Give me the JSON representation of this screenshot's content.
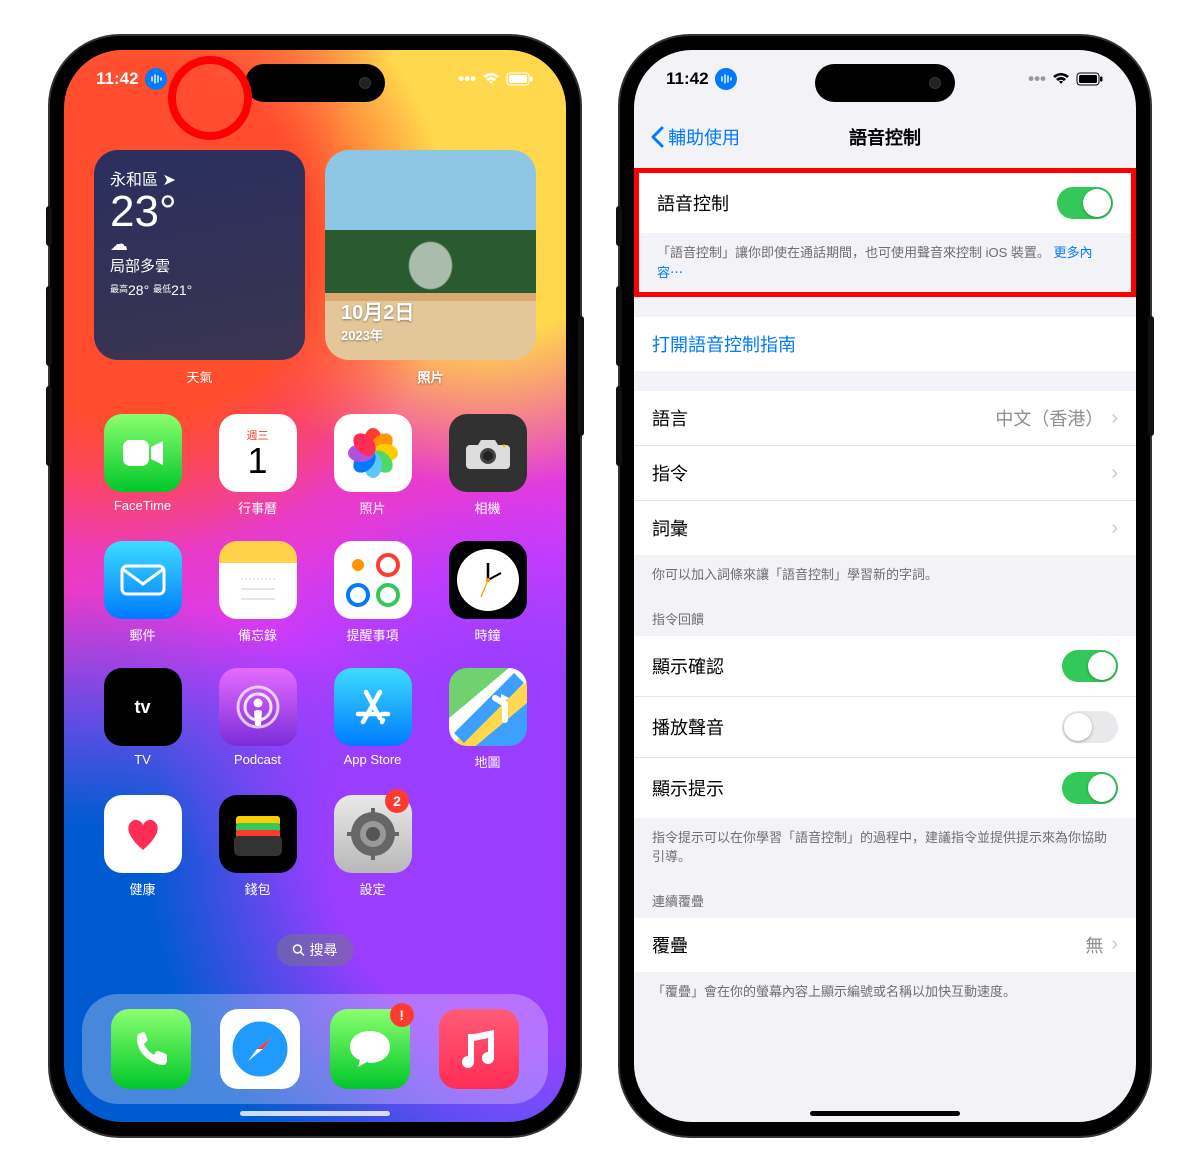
{
  "home": {
    "status": {
      "time": "11:42"
    },
    "weather": {
      "location": "永和區",
      "temp": "23°",
      "condition": "局部多雲",
      "hi_label": "最高",
      "hi": "28°",
      "lo_label": "最低",
      "lo": "21°",
      "widget_label": "天氣"
    },
    "photos_widget": {
      "date": "10月2日",
      "year": "2023年",
      "widget_label": "照片"
    },
    "apps": {
      "facetime": "FaceTime",
      "calendar": {
        "label": "行事曆",
        "dow": "週三",
        "day": "1"
      },
      "photos": "照片",
      "camera": "相機",
      "mail": "郵件",
      "notes": "備忘錄",
      "reminders": "提醒事項",
      "clock": "時鐘",
      "tv": "TV",
      "podcast": "Podcast",
      "appstore": "App Store",
      "maps": "地圖",
      "health": "健康",
      "wallet": "錢包",
      "settings": {
        "label": "設定",
        "badge": "2"
      },
      "messages_badge": "!"
    },
    "tv_glyph": "tv",
    "search": "搜尋"
  },
  "settings": {
    "status": {
      "time": "11:42"
    },
    "back": "輔助使用",
    "title": "語音控制",
    "main_toggle": {
      "label": "語音控制"
    },
    "main_footer": "「語音控制」讓你即使在通話期間，也可使用聲音來控制 iOS 裝置。",
    "more_link": "更多內容⋯",
    "guide": "打開語音控制指南",
    "language": {
      "label": "語言",
      "value": "中文（香港）"
    },
    "commands": "指令",
    "vocab": "詞彙",
    "vocab_footer": "你可以加入詞條來讓「語音控制」學習新的字詞。",
    "feedback_header": "指令回饋",
    "show_confirm": "顯示確認",
    "play_sound": "播放聲音",
    "show_hints": "顯示提示",
    "hints_footer": "指令提示可以在你學習「語音控制」的過程中，建議指令並提供提示來為你協助引導。",
    "overlay_header": "連續覆疊",
    "overlay": {
      "label": "覆疊",
      "value": "無"
    },
    "overlay_footer": "「覆疊」會在你的螢幕內容上顯示編號或名稱以加快互動速度。"
  }
}
